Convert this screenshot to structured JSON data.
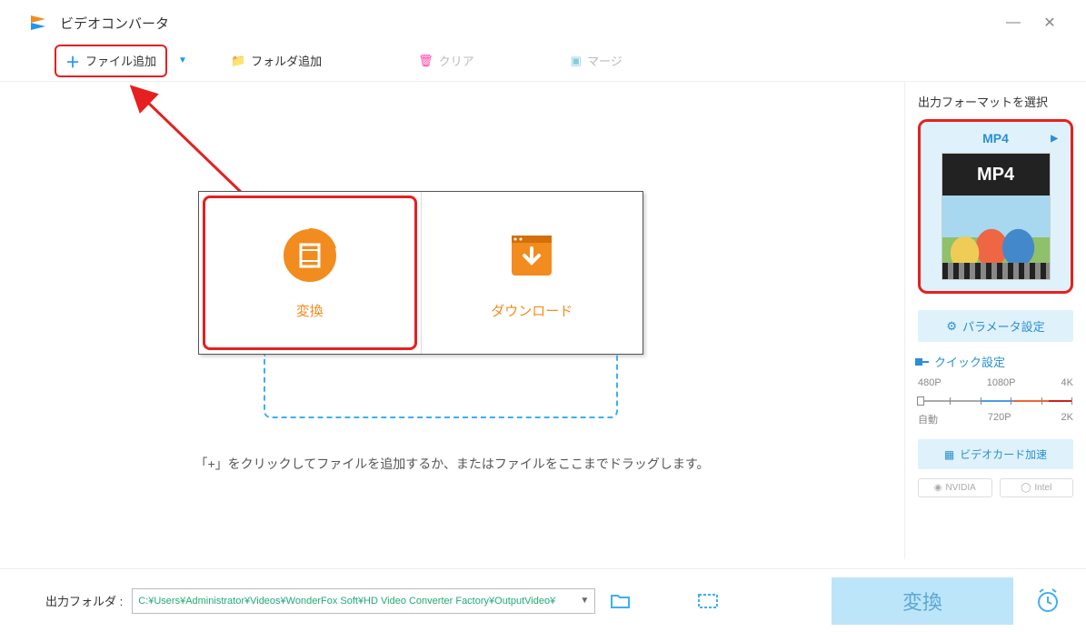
{
  "app": {
    "title": "ビデオコンバータ"
  },
  "toolbar": {
    "add_file_label": "ファイル追加",
    "add_folder_label": "フォルダ追加",
    "clear_label": "クリア",
    "merge_label": "マージ"
  },
  "cards": {
    "convert_label": "変換",
    "download_label": "ダウンロード"
  },
  "drop_hint": "「+」をクリックしてファイルを追加するか、またはファイルをここまでドラッグします。",
  "sidebar": {
    "select_format_label": "出力フォーマットを選択",
    "current_format": "MP4",
    "thumb_label": "MP4",
    "param_settings_label": "パラメータ設定",
    "quick_settings_label": "クイック設定",
    "resolutions_top": [
      "480P",
      "1080P",
      "4K"
    ],
    "resolutions_bottom": [
      "自動",
      "720P",
      "2K"
    ],
    "gpu_accel_label": "ビデオカード加速",
    "vendors": [
      "NVIDIA",
      "Intel"
    ]
  },
  "footer": {
    "output_folder_label": "出力フォルダ :",
    "output_path": "C:¥Users¥Administrator¥Videos¥WonderFox Soft¥HD Video Converter Factory¥OutputVideo¥",
    "convert_label": "変換"
  }
}
